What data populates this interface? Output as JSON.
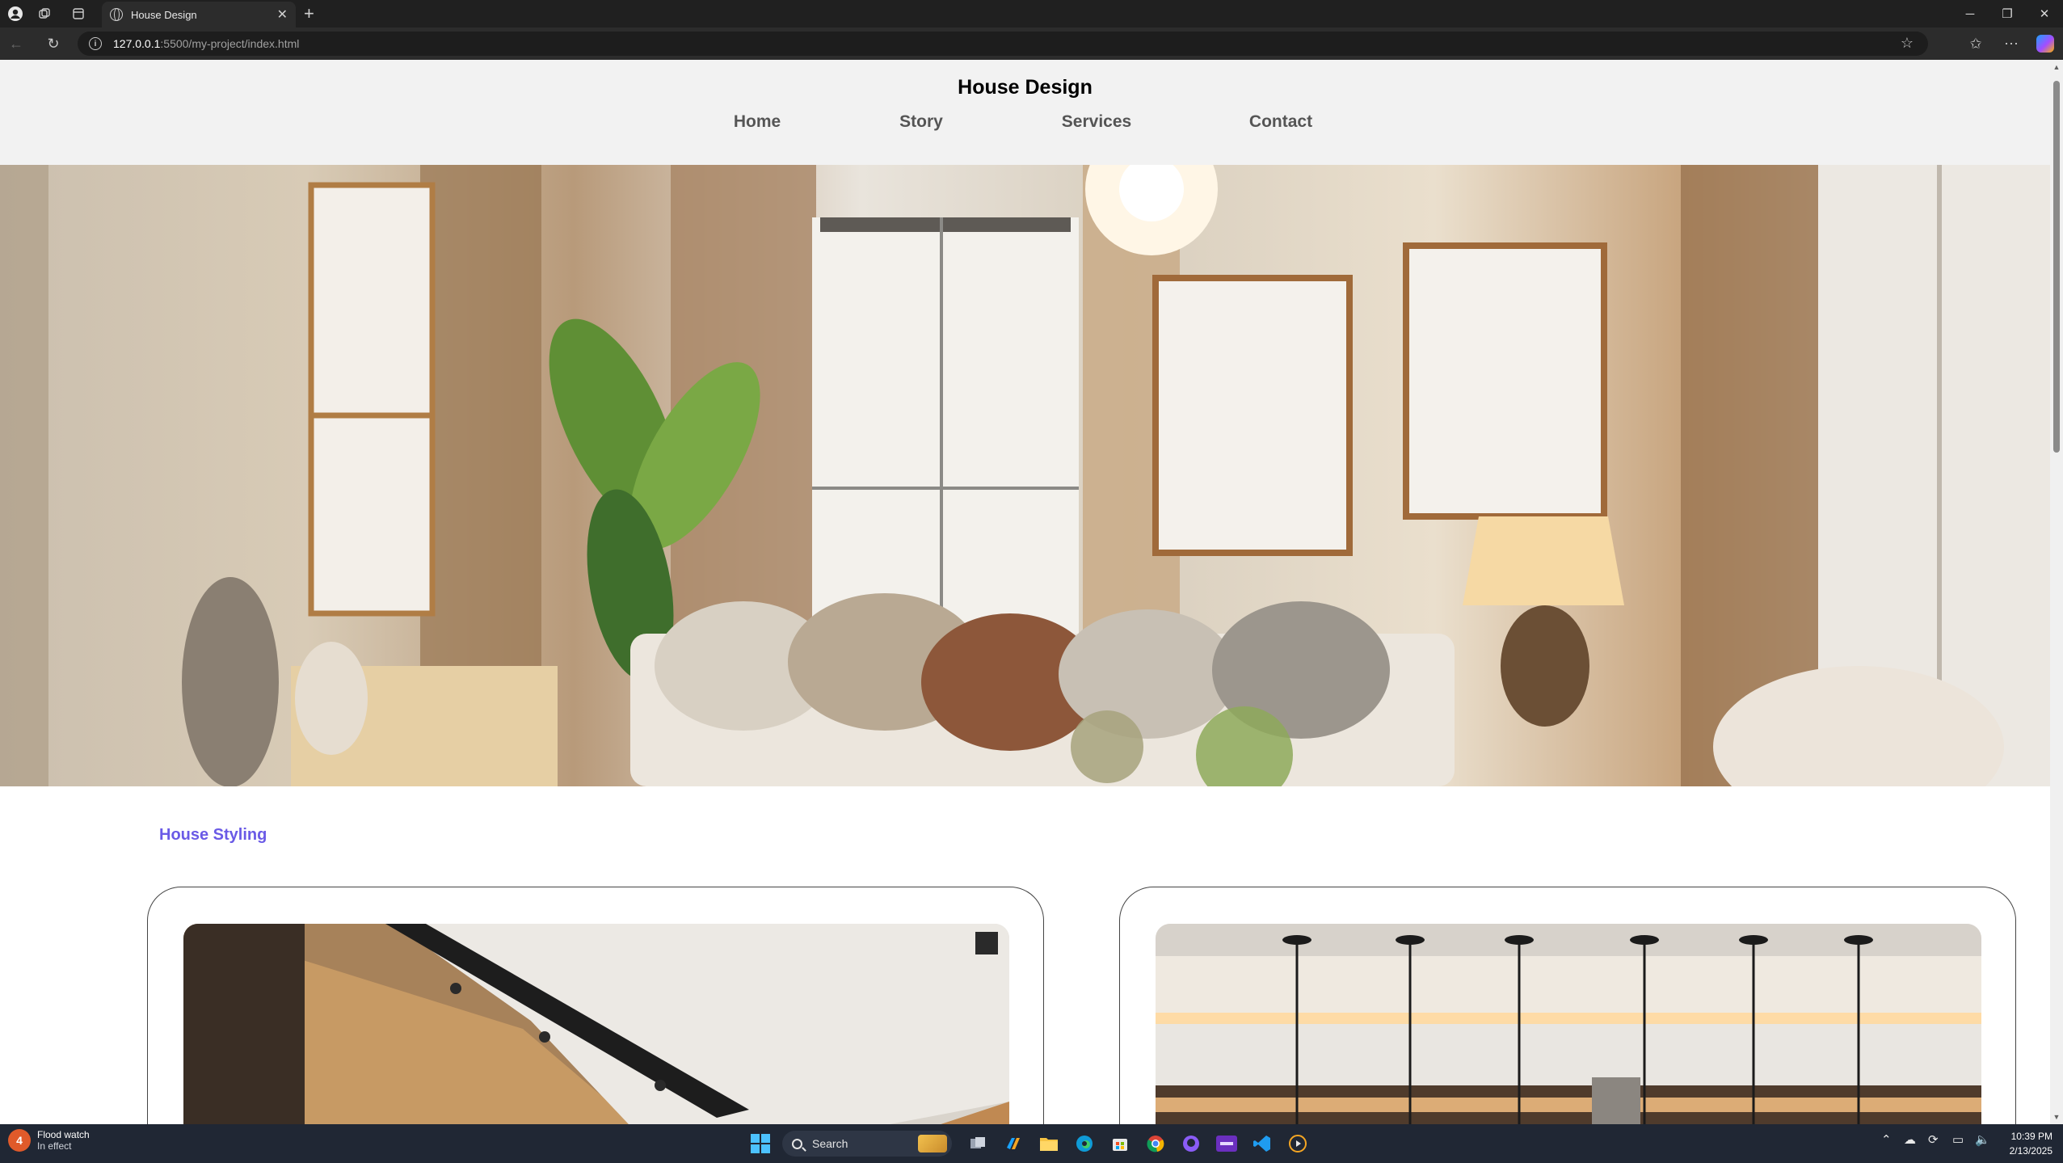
{
  "browser": {
    "tab_title": "House Design",
    "url_host": "127.0.0.1",
    "url_path": ":5500/my-project/index.html"
  },
  "site": {
    "title": "House Design",
    "nav": [
      "Home",
      "Story",
      "Services",
      "Contact"
    ],
    "section_title": "House Styling"
  },
  "taskbar": {
    "weather_line1": "Flood watch",
    "weather_line2": "In effect",
    "weather_badge": "4",
    "search_placeholder": "Search",
    "time": "10:39 PM",
    "date": "2/13/2025"
  },
  "colors": {
    "accent_section_title": "#6a5ae6",
    "nav_text": "#555555",
    "header_bg": "#f2f2f2",
    "taskbar_bg": "#202734"
  }
}
